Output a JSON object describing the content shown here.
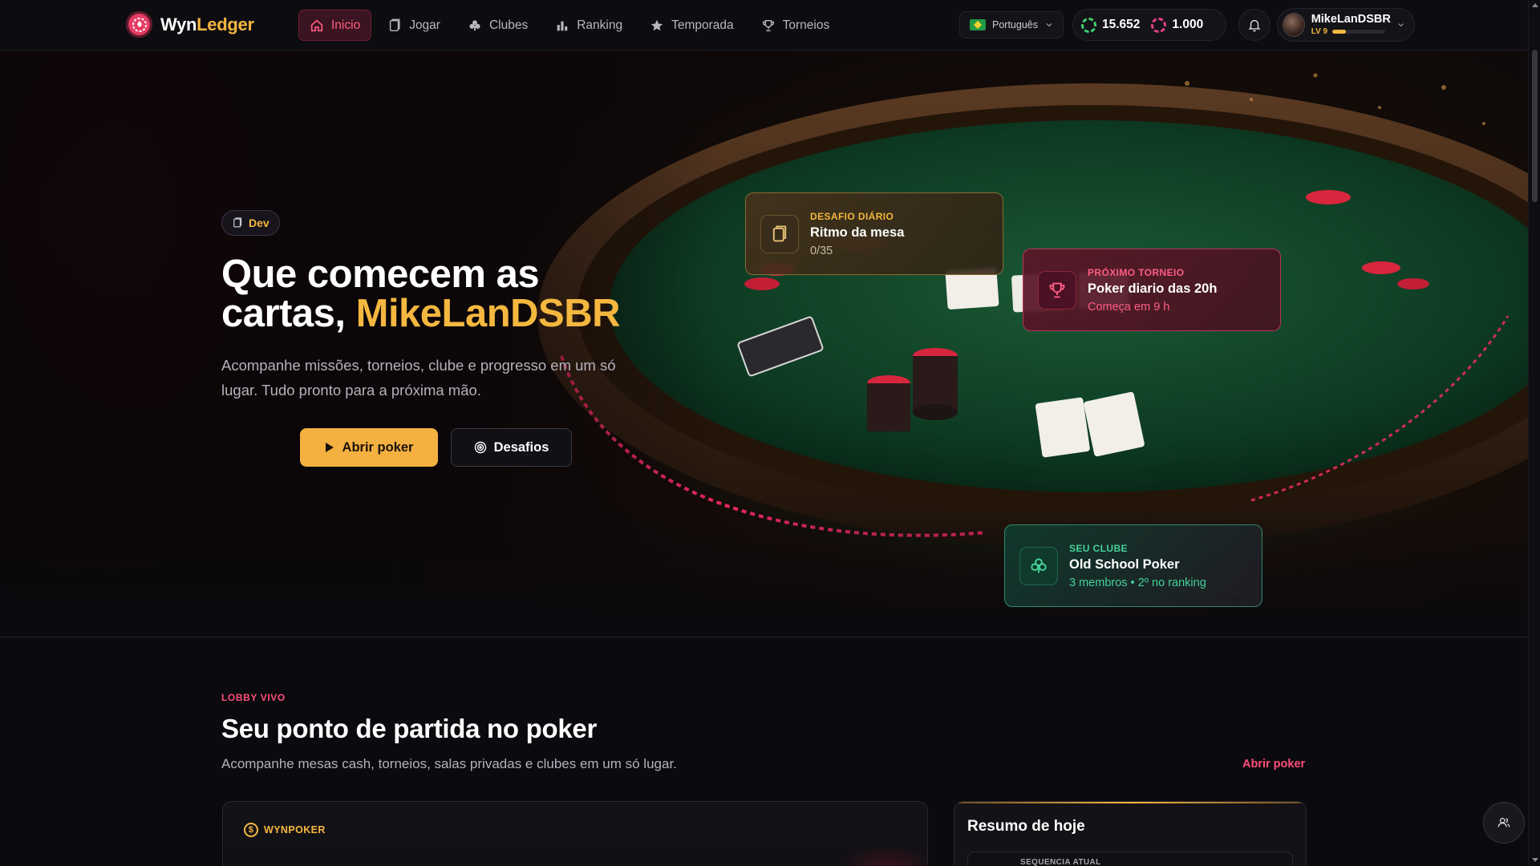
{
  "brand": {
    "name_part1": "Wyn",
    "name_part2": "Ledger",
    "accent": "#e63c64",
    "gold": "#f4b73f"
  },
  "nav": {
    "items": [
      {
        "label": "Inicio",
        "icon": "home-icon",
        "active": true
      },
      {
        "label": "Jogar",
        "icon": "cards-icon"
      },
      {
        "label": "Clubes",
        "icon": "club-icon"
      },
      {
        "label": "Ranking",
        "icon": "bar-chart-icon"
      },
      {
        "label": "Temporada",
        "icon": "star-icon"
      },
      {
        "label": "Torneios",
        "icon": "trophy-icon"
      }
    ],
    "language": "Português",
    "balance_chips": "15.652",
    "balance_gems": "1.000",
    "username": "MikeLanDSBR",
    "level": "LV 9",
    "level_progress": 0.25
  },
  "hero": {
    "badge": "Dev",
    "title_prefix": "Que comecem as cartas, ",
    "title_name": "MikeLanDSBR",
    "subtitle": "Acompanhe missões, torneios, clube e progresso em um só lugar. Tudo pronto para a próxima mão.",
    "primary_button": "Abrir poker",
    "secondary_button": "Desafios",
    "cards": {
      "daily": {
        "kicker": "DESAFIO DIÁRIO",
        "title": "Ritmo da mesa",
        "sub": "0/35"
      },
      "tournament": {
        "kicker": "PRÓXIMO TORNEIO",
        "title": "Poker diario das 20h",
        "sub": "Começa em 9 h"
      },
      "club": {
        "kicker": "SEU CLUBE",
        "title": "Old School Poker",
        "sub": "3 membros • 2º no ranking"
      }
    }
  },
  "lobby": {
    "kicker": "LOBBY VIVO",
    "title": "Seu ponto de partida no poker",
    "subtitle": "Acompanhe mesas cash, torneios, salas privadas e clubes em um só lugar.",
    "link": "Abrir poker",
    "panel_left_label": "WYNPOKER",
    "panel_right_title": "Resumo de hoje",
    "panel_right_box": "SEQUENCIA ATUAL"
  }
}
